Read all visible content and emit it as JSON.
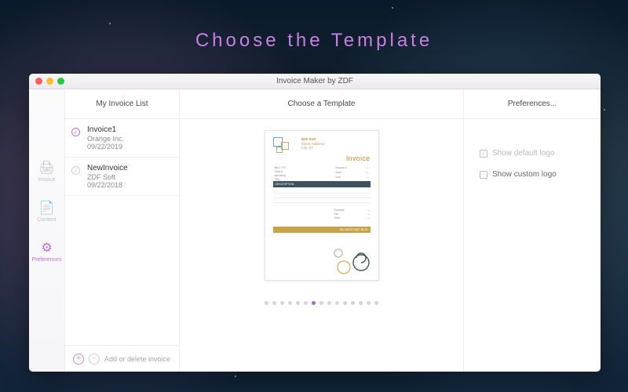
{
  "page_title": "Choose  the  Template",
  "window_title": "Invoice Maker by ZDF",
  "rail": {
    "items": [
      {
        "icon": "🖨",
        "label": "Invoice"
      },
      {
        "icon": "📄",
        "label": "Content"
      },
      {
        "icon": "⚙",
        "label": "Preferences"
      }
    ],
    "active_index": 2
  },
  "list": {
    "header": "My Invoice List",
    "items": [
      {
        "title": "Invoice1",
        "client": "Orange Inc.",
        "date": "09/22/2019",
        "selected": true
      },
      {
        "title": "NewInvoice",
        "client": "ZDF Soft",
        "date": "09/22/2018",
        "selected": false
      }
    ],
    "footer_label": "Add or delete invoice"
  },
  "template": {
    "header": "Choose a Template",
    "preview": {
      "company": "ZDF Soft",
      "invoice_word": "Invoice"
    },
    "page_count": 15,
    "active_page": 6
  },
  "prefs": {
    "header": "Preferences...",
    "show_default_label": "Show default logo",
    "show_custom_label": "Show custom logo",
    "show_default_checked": true,
    "show_custom_checked": false
  }
}
